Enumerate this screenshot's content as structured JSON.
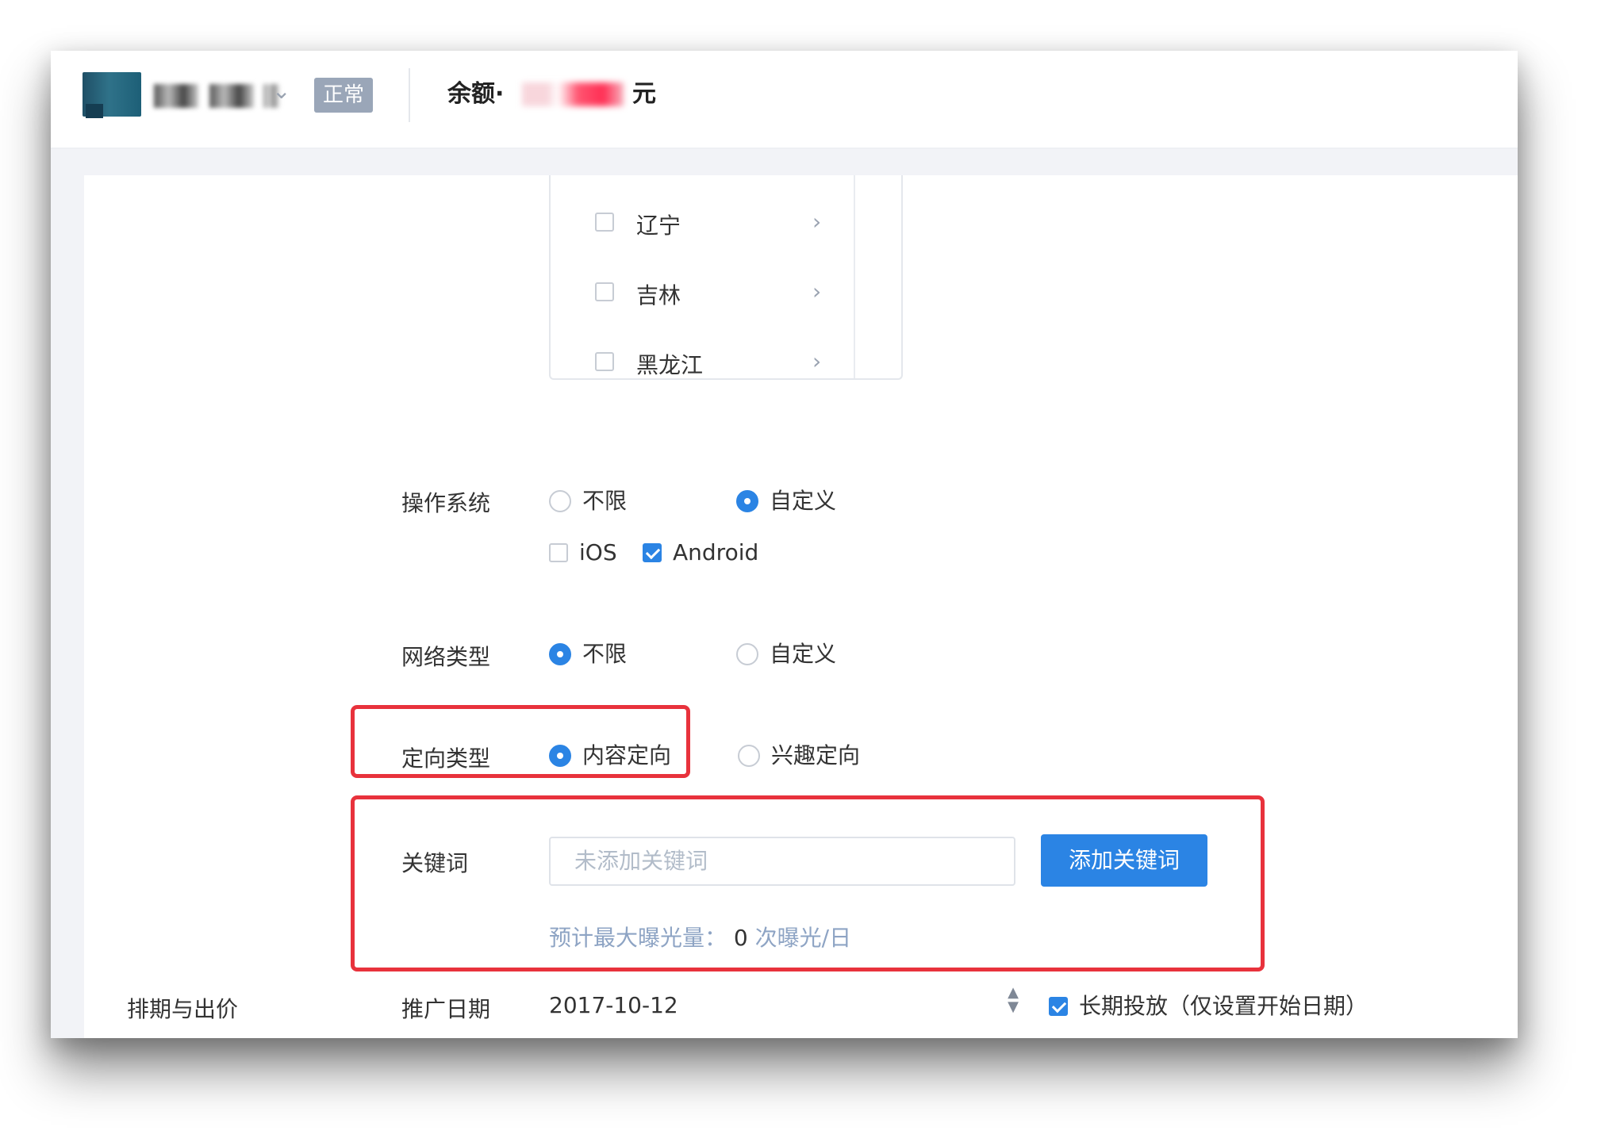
{
  "header": {
    "status_badge": "正常",
    "balance_label": "余额·",
    "balance_unit": "元"
  },
  "region_list": {
    "items": [
      {
        "label": "辽宁",
        "checked": false
      },
      {
        "label": "吉林",
        "checked": false
      },
      {
        "label": "黑龙江",
        "checked": false
      }
    ]
  },
  "os": {
    "label": "操作系统",
    "options": [
      "不限",
      "自定义"
    ],
    "selected": "自定义",
    "platforms": [
      {
        "label": "iOS",
        "checked": false
      },
      {
        "label": "Android",
        "checked": true
      }
    ]
  },
  "network": {
    "label": "网络类型",
    "options": [
      "不限",
      "自定义"
    ],
    "selected": "不限"
  },
  "targeting": {
    "label": "定向类型",
    "options": [
      "内容定向",
      "兴趣定向"
    ],
    "selected": "内容定向"
  },
  "keywords": {
    "label": "关键词",
    "placeholder": "未添加关键词",
    "button": "添加关键词",
    "estimate_prefix": "预计最大曝光量：",
    "estimate_value": "0",
    "estimate_suffix": "次曝光/日"
  },
  "schedule": {
    "section_label": "排期与出价",
    "date_label": "推广日期",
    "date_value": "2017-10-12",
    "long_term_label": "长期投放（仅设置开始日期）",
    "long_term_checked": true
  },
  "colors": {
    "accent": "#2b84e4",
    "highlight": "#e8323c",
    "status_badge": "#9aa6b8"
  }
}
